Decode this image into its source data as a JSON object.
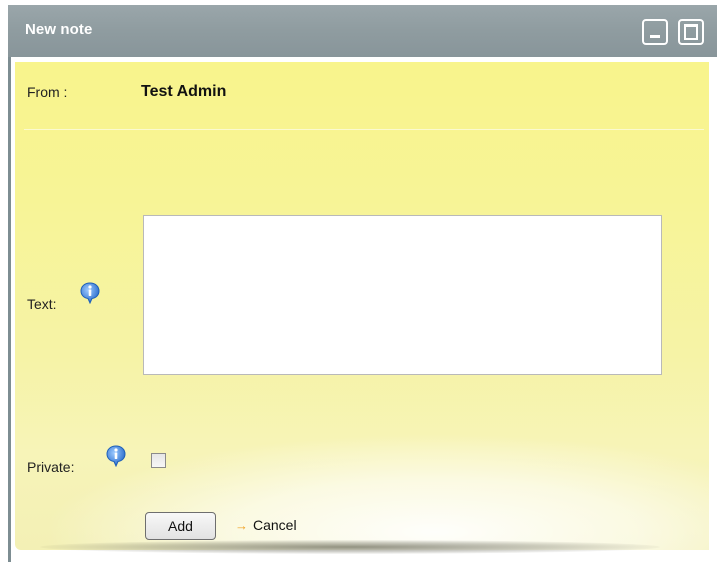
{
  "window": {
    "title": "New note",
    "minimize_icon": "minimize-icon",
    "maximize_icon": "maximize-icon"
  },
  "form": {
    "from_label": "From :",
    "from_value": "Test Admin",
    "text_label": "Text:",
    "text_value": "",
    "text_info_icon": "info-icon",
    "private_label": "Private:",
    "private_checked": false,
    "private_info_icon": "info-icon"
  },
  "actions": {
    "add_label": "Add",
    "cancel_label": "Cancel",
    "cancel_icon": "arrow-right-icon"
  },
  "colors": {
    "titlebar": "#8f9ca0",
    "paper": "#f7f497",
    "info_icon": "#3a7fd0",
    "cancel_arrow": "#f0a020"
  }
}
